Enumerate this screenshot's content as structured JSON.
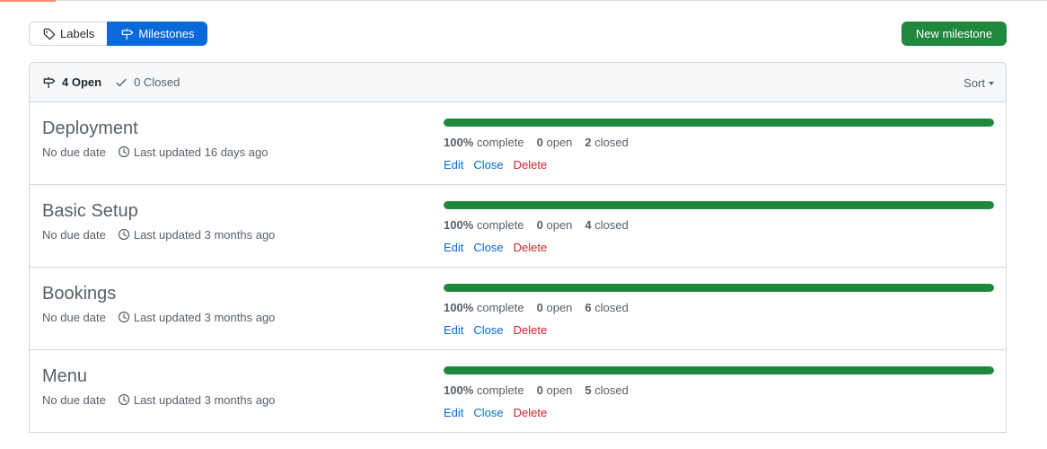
{
  "subnav": {
    "labels": "Labels",
    "milestones": "Milestones"
  },
  "new_milestone_button": "New milestone",
  "filters": {
    "open": "4 Open",
    "closed": "0 Closed",
    "sort": "Sort"
  },
  "colors": {
    "accent": "#0969da",
    "success": "#1f883d",
    "danger": "#cf222e"
  },
  "milestones": [
    {
      "title": "Deployment",
      "due": "No due date",
      "updated": "Last updated 16 days ago",
      "percent_label": "100%",
      "percent_word": "complete",
      "open_count": "0",
      "open_word": "open",
      "closed_count": "2",
      "closed_word": "closed",
      "progress": 100,
      "edit": "Edit",
      "close": "Close",
      "delete": "Delete"
    },
    {
      "title": "Basic Setup",
      "due": "No due date",
      "updated": "Last updated 3 months ago",
      "percent_label": "100%",
      "percent_word": "complete",
      "open_count": "0",
      "open_word": "open",
      "closed_count": "4",
      "closed_word": "closed",
      "progress": 100,
      "edit": "Edit",
      "close": "Close",
      "delete": "Delete"
    },
    {
      "title": "Bookings",
      "due": "No due date",
      "updated": "Last updated 3 months ago",
      "percent_label": "100%",
      "percent_word": "complete",
      "open_count": "0",
      "open_word": "open",
      "closed_count": "6",
      "closed_word": "closed",
      "progress": 100,
      "edit": "Edit",
      "close": "Close",
      "delete": "Delete"
    },
    {
      "title": "Menu",
      "due": "No due date",
      "updated": "Last updated 3 months ago",
      "percent_label": "100%",
      "percent_word": "complete",
      "open_count": "0",
      "open_word": "open",
      "closed_count": "5",
      "closed_word": "closed",
      "progress": 100,
      "edit": "Edit",
      "close": "Close",
      "delete": "Delete"
    }
  ]
}
